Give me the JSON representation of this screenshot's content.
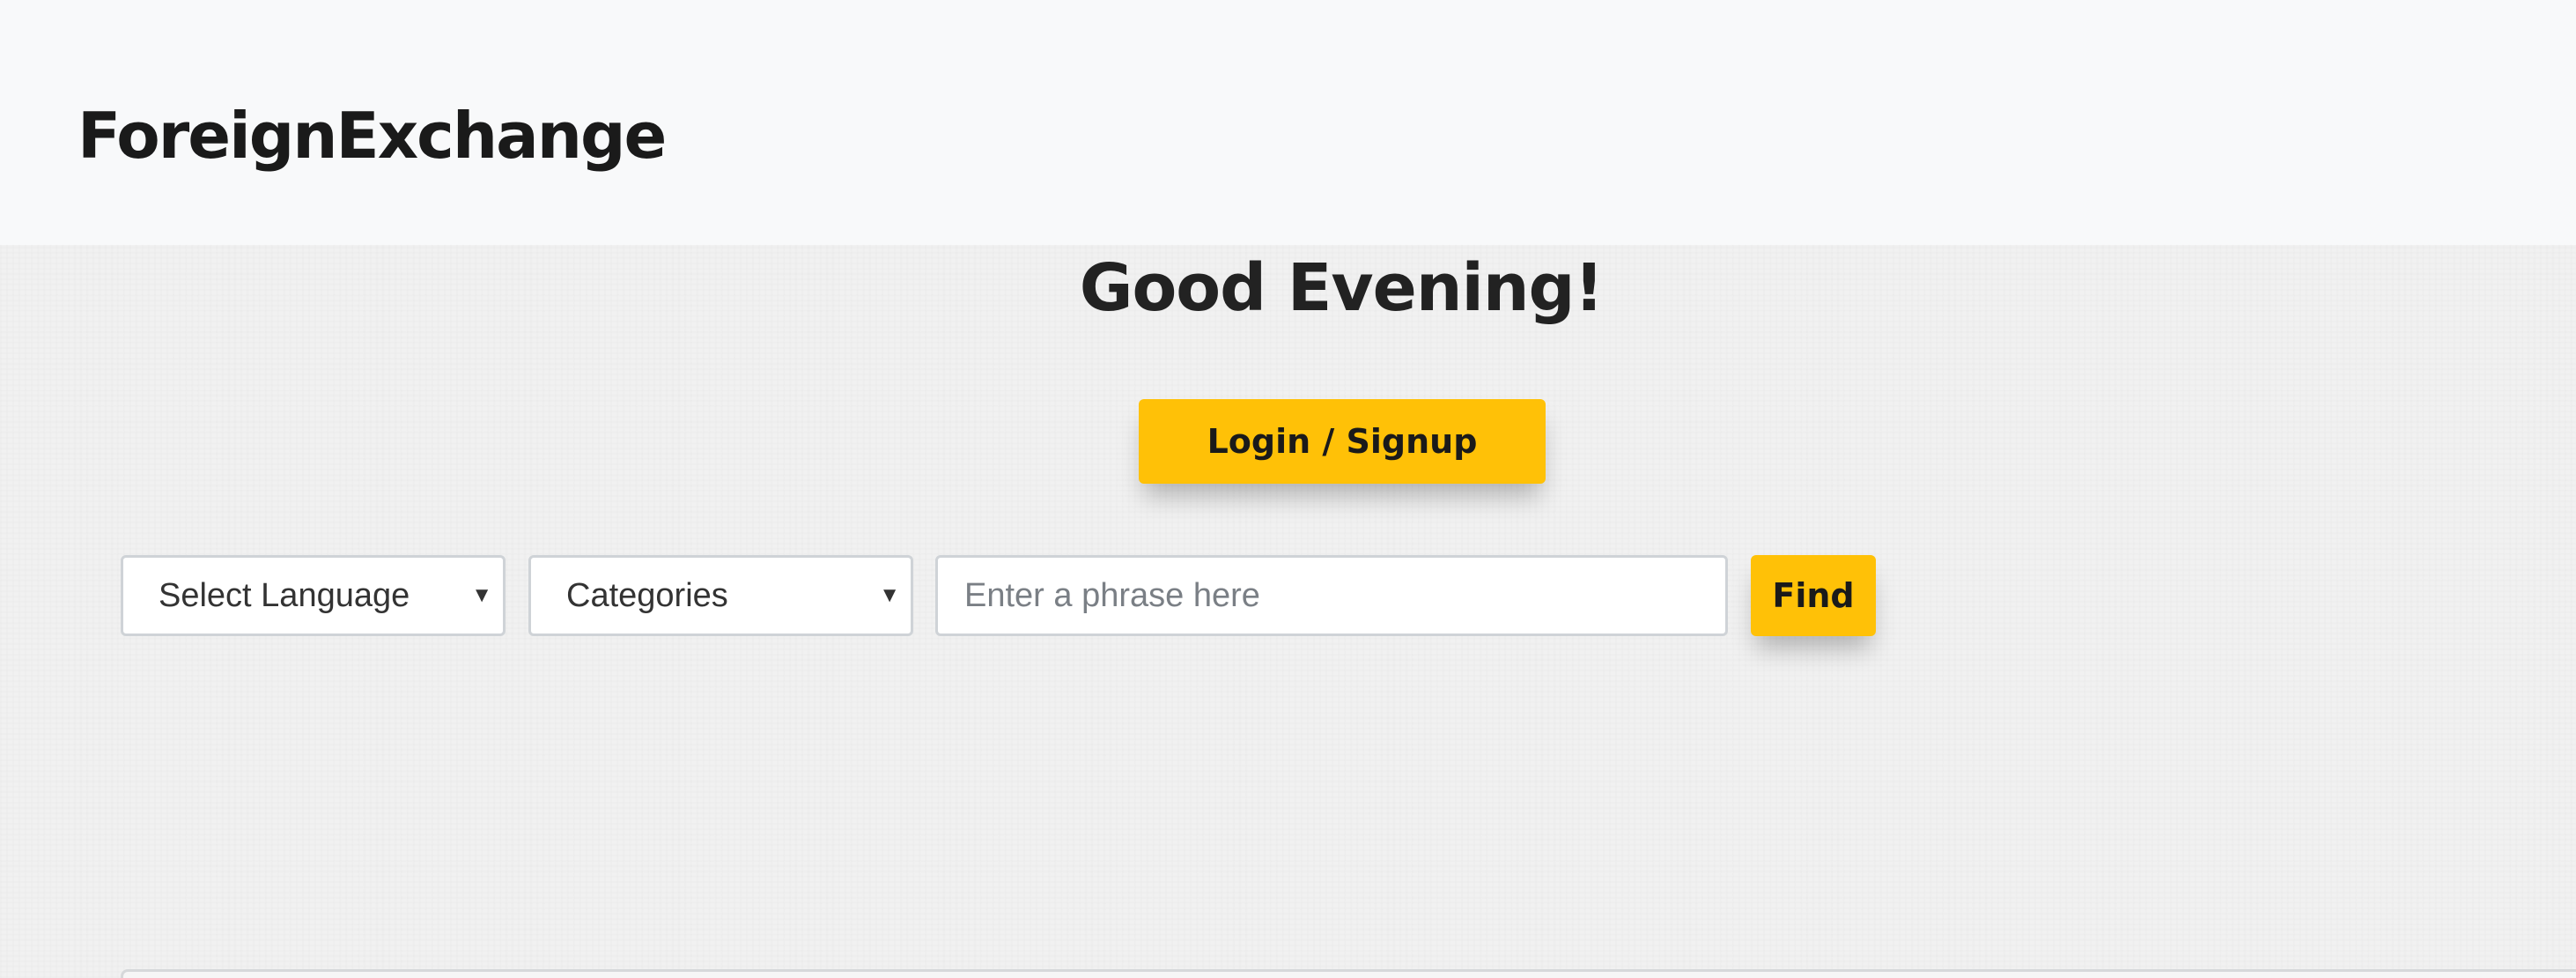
{
  "navbar": {
    "brand": "ForeignExchange"
  },
  "hero": {
    "greeting": "Good Evening!",
    "login_label": "Login / Signup"
  },
  "search": {
    "language_select": {
      "selected": "Select Language"
    },
    "category_select": {
      "selected": "Categories"
    },
    "phrase_input": {
      "value": "",
      "placeholder": "Enter a phrase here"
    },
    "find_label": "Find"
  },
  "colors": {
    "accent": "#ffc107",
    "navbar_bg": "#f8f9fa",
    "page_bg": "#f1f1f1",
    "text": "#1a1a1a"
  },
  "icons": {
    "select_caret": "chevron-down-icon"
  }
}
